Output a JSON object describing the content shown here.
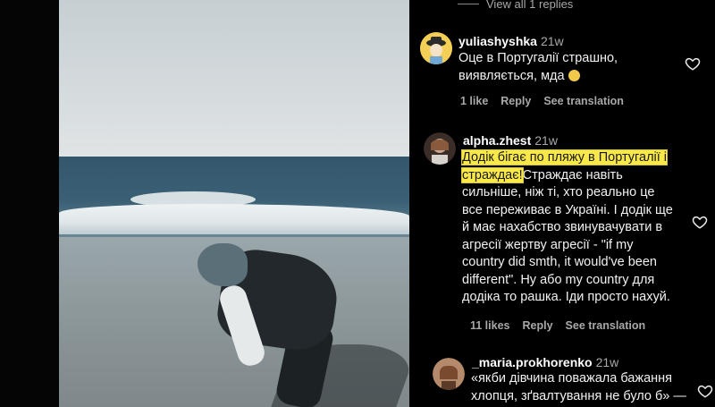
{
  "thread": {
    "view_replies": "View all 1 replies"
  },
  "comments": [
    {
      "username": "yuliashyshka",
      "time": "21w",
      "lines": [
        "Оце в Португалії страшно,",
        "виявляється, мда"
      ],
      "likes": "1 like",
      "reply": "Reply",
      "translate": "See translation",
      "avatar_colors": {
        "bg": "#f0c23b",
        "hat": "#2b2b2b"
      }
    },
    {
      "username": "alpha.zhest",
      "time": "21w",
      "highlight_lines": [
        "Додік бігає по пляжу в Португалії і",
        "страждає!"
      ],
      "after_highlight": "Страждає навіть",
      "lines": [
        "сильніше, ніж ті, хто реально це",
        "все переживає в Україні. І додік ще",
        "й має нахабство звинувачувати в",
        "агресії жертву агресії - \"if my",
        "country did smth, it would've been",
        "different\". Ну або my country для",
        "додіка то рашка. Іди просто нахуй."
      ],
      "likes": "11 likes",
      "reply": "Reply",
      "translate": "See translation"
    },
    {
      "username": "_maria.prokhorenko",
      "time": "21w",
      "lines": [
        "«якби дівчина поважала бажання",
        "хлопця, зґвалтування не було б» —"
      ]
    }
  ],
  "colors": {
    "highlight": "#f8e84a",
    "text": "#f2f2f2",
    "muted": "#a8a8a8"
  },
  "icons": [
    "heart-icon",
    "emoji-icon"
  ]
}
